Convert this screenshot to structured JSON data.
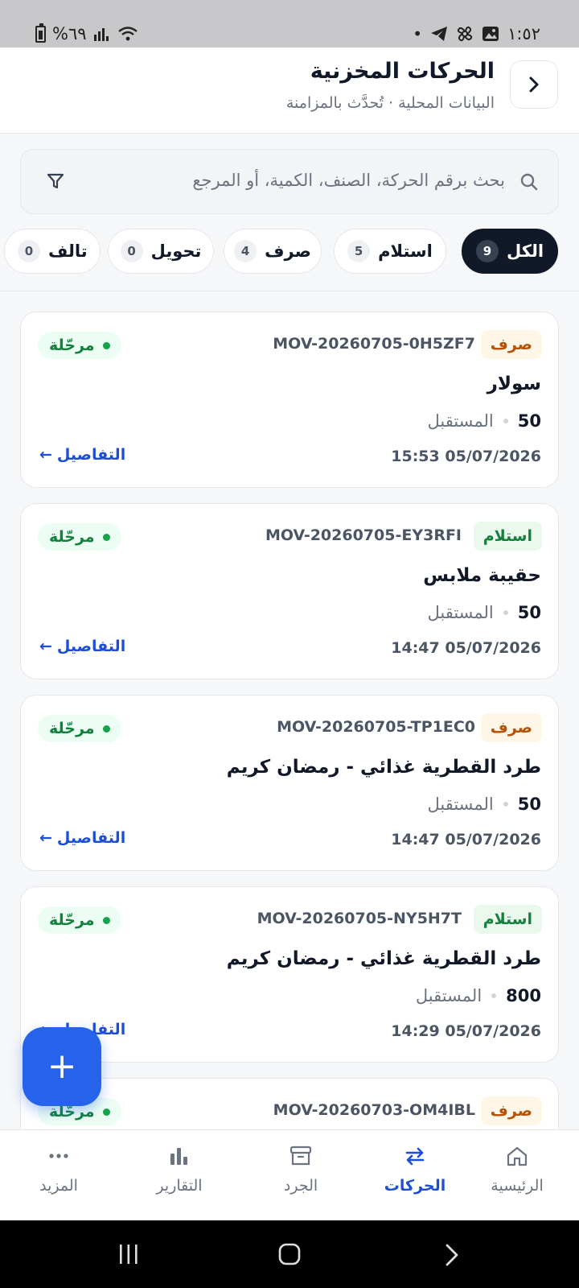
{
  "status_bar": {
    "battery": "%٦٩",
    "time": "١:٥٢"
  },
  "header": {
    "title": "الحركات المخزنية",
    "subtitle": "البيانات المحلية · تُحدَّث بالمزامنة",
    "back_icon": "chevron-right-icon"
  },
  "search": {
    "placeholder": "بحث برقم الحركة، الصنف، الكمية، أو المرجع",
    "icon": "search-icon",
    "filter_icon": "filter-icon"
  },
  "filters": [
    {
      "label": "الكل",
      "count": "9",
      "active": true
    },
    {
      "label": "استلام",
      "count": "5",
      "active": false
    },
    {
      "label": "صرف",
      "count": "4",
      "active": false
    },
    {
      "label": "تحويل",
      "count": "0",
      "active": false
    },
    {
      "label": "تالف",
      "count": "0",
      "active": false
    }
  ],
  "movements": [
    {
      "type": "صرف",
      "type_kind": "out",
      "code": "MOV-20260705-0H5ZF7",
      "status": "مرحّلة",
      "item": "سولار",
      "qty": "50",
      "dest": "المستقبل",
      "date": "15:53 05/07/2026",
      "details": "التفاصيل"
    },
    {
      "type": "استلام",
      "type_kind": "in",
      "code": "MOV-20260705-EY3RFI",
      "status": "مرحّلة",
      "item": "حقيبة ملابس",
      "qty": "50",
      "dest": "المستقبل",
      "date": "14:47 05/07/2026",
      "details": "التفاصيل"
    },
    {
      "type": "صرف",
      "type_kind": "out",
      "code": "MOV-20260705-TP1EC0",
      "status": "مرحّلة",
      "item": "طرد القطرية غذائي - رمضان كريم",
      "qty": "50",
      "dest": "المستقبل",
      "date": "14:47 05/07/2026",
      "details": "التفاصيل"
    },
    {
      "type": "استلام",
      "type_kind": "in",
      "code": "MOV-20260705-NY5H7T",
      "status": "مرحّلة",
      "item": "طرد القطرية غذائي - رمضان كريم",
      "qty": "800",
      "dest": "المستقبل",
      "date": "14:29 05/07/2026",
      "details": "التفاصيل"
    },
    {
      "type": "صرف",
      "type_kind": "out",
      "code": "MOV-20260703-OM4IBL",
      "status": "مرحّلة",
      "item": "",
      "qty": "",
      "dest": "",
      "date": "",
      "details": ""
    }
  ],
  "fab": {
    "label": "+",
    "icon": "plus-icon"
  },
  "bottom_nav": [
    {
      "label": "الرئيسية",
      "icon": "home-icon",
      "active": false
    },
    {
      "label": "الحركات",
      "icon": "arrows-swap-icon",
      "active": true
    },
    {
      "label": "الجرد",
      "icon": "archive-box-icon",
      "active": false
    },
    {
      "label": "التقارير",
      "icon": "bar-chart-icon",
      "active": false
    },
    {
      "label": "المزيد",
      "icon": "more-dots-icon",
      "active": false
    }
  ],
  "colors": {
    "accent": "#2563eb",
    "active_chip": "#111827",
    "out_badge": "#b45309",
    "in_badge": "#15803d"
  }
}
